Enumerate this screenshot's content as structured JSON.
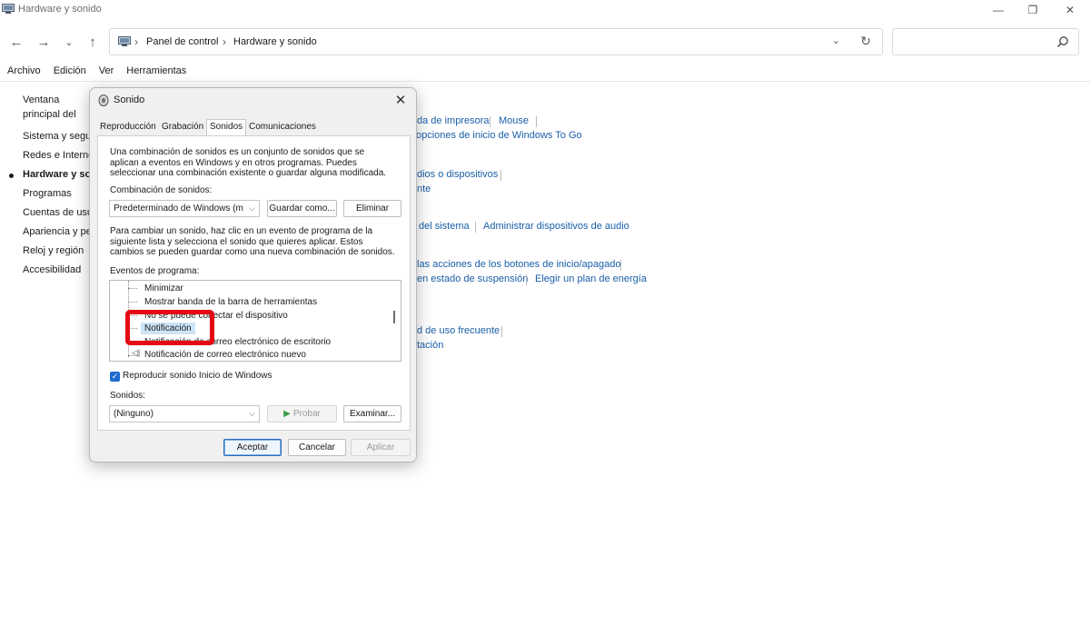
{
  "window": {
    "title": "Hardware y sonido",
    "controls": {
      "minimize": "—",
      "restore": "❐",
      "close": "✕"
    }
  },
  "nav": {
    "back": "←",
    "forward": "→",
    "recent": "⌄",
    "up": "↑",
    "breadcrumbs": [
      "Panel de control",
      "Hardware y sonido"
    ],
    "separator": "›",
    "dropdown": "⌄",
    "refresh": "↻"
  },
  "search": {
    "placeholder": ""
  },
  "menu": [
    "Archivo",
    "Edición",
    "Ver",
    "Herramientas"
  ],
  "sidebar": {
    "items": [
      {
        "label": "Ventana principal del Panel de control"
      },
      {
        "label": "Sistema y seguridad"
      },
      {
        "label": "Redes e Internet"
      },
      {
        "label": "Hardware y sonido"
      },
      {
        "label": "Programas"
      },
      {
        "label": "Cuentas de usuario"
      },
      {
        "label": "Apariencia y personalización"
      },
      {
        "label": "Reloj y región"
      },
      {
        "label": "Accesibilidad"
      }
    ]
  },
  "main_links": [
    "da de impresora",
    "Mouse",
    "opciones de inicio de Windows To Go",
    "dios o dispositivos",
    "nte",
    "del sistema",
    "Administrar dispositivos de audio",
    "las acciones de los botones de inicio/apagado",
    "en estado de suspensión",
    "Elegir un plan de energía",
    "d de uso frecuente",
    "tación"
  ],
  "dialog": {
    "title": "Sonido",
    "close": "✕",
    "tabs": [
      "Reproducción",
      "Grabación",
      "Sonidos",
      "Comunicaciones"
    ],
    "intro_lines": [
      "Una combinación de sonidos es un conjunto de sonidos que se",
      "aplican a eventos en Windows y en otros programas. Puedes",
      "seleccionar una combinación existente o guardar alguna modificada."
    ],
    "scheme_label": "Combinación de sonidos:",
    "scheme_value": "Predeterminado de Windows (m",
    "save_as": "Guardar como...",
    "delete": "Eliminar",
    "instr_lines": [
      "Para cambiar un sonido, haz clic en un evento de programa de la",
      "siguiente lista y selecciona el sonido que quieres aplicar. Estos",
      "cambios se pueden guardar como una nueva combinación de sonidos."
    ],
    "events_label": "Eventos de programa:",
    "events": [
      "Minimizar",
      "Mostrar banda de la barra de herramientas",
      "No se puede conectar el dispositivo",
      "Notificación",
      "Notificación de correo electrónico de escritorio",
      "Notificación de correo electrónico nuevo"
    ],
    "startup_sound": "Reproducir sonido Inicio de Windows",
    "sounds_label": "Sonidos:",
    "sound_value": "(Ninguno)",
    "test": "Probar",
    "browse": "Examinar...",
    "ok": "Aceptar",
    "cancel": "Cancelar",
    "apply": "Aplicar"
  },
  "colors": {
    "link": "#1a5fa8",
    "highlight": "#e50914",
    "accent": "#1f6cd1"
  }
}
